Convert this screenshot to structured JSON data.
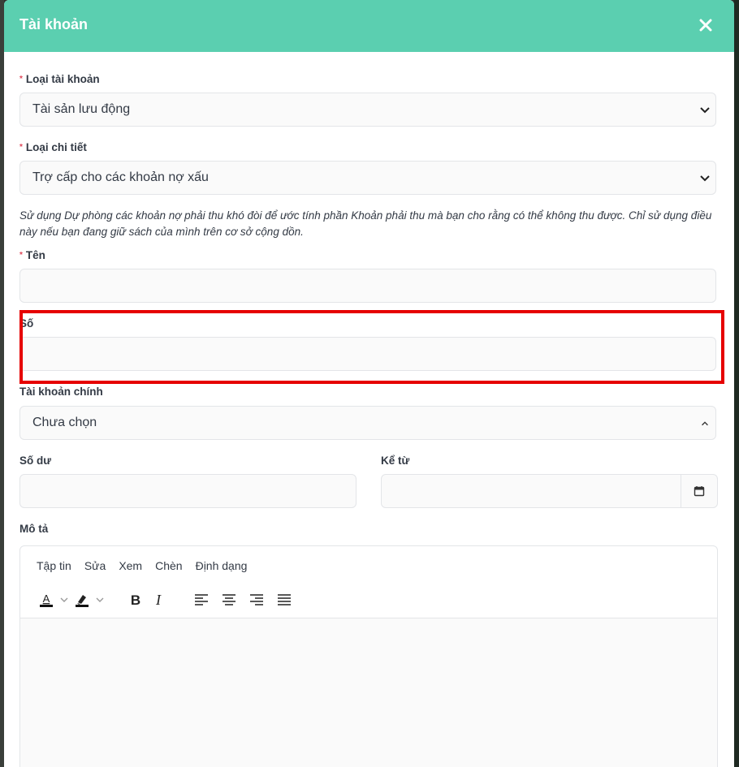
{
  "modal": {
    "title": "Tài khoản"
  },
  "account_type": {
    "label": "Loại tài khoản",
    "value": "Tài sản lưu động"
  },
  "detail_type": {
    "label": "Loại chi tiết",
    "value": "Trợ cấp cho các khoản nợ xấu"
  },
  "description_line1": "Sử dụng Dự phòng các khoản nợ phải thu khó đòi để ước tính phần Khoản phải thu mà bạn cho rằng có thể không thu được. Chỉ sử dụng điều này nếu bạn đang giữ sách của mình trên cơ sở cộng dồn.",
  "name_field": {
    "label": "Tên",
    "value": ""
  },
  "number_field": {
    "label": "Số",
    "value": ""
  },
  "parent_account": {
    "label": "Tài khoản chính",
    "value": "Chưa chọn"
  },
  "balance": {
    "label": "Số dư",
    "value": ""
  },
  "as_of": {
    "label": "Kể từ",
    "value": ""
  },
  "description": {
    "label": "Mô tả",
    "menu": [
      "Tập tin",
      "Sửa",
      "Xem",
      "Chèn",
      "Định dạng"
    ]
  },
  "colors": {
    "header": "#5bcfb0",
    "required": "#e0485a",
    "highlight": "#e60000"
  }
}
